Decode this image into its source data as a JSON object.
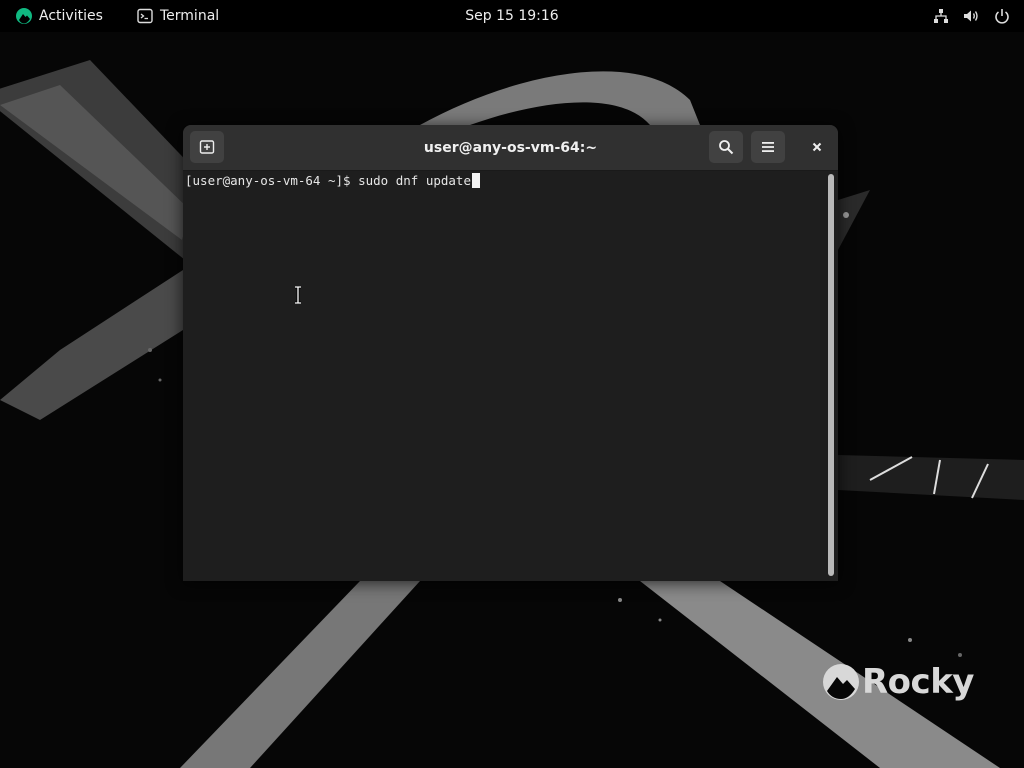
{
  "topbar": {
    "activities_label": "Activities",
    "app_label": "Terminal",
    "clock": "Sep 15  19:16"
  },
  "icons": {
    "activities": "rocky-logo-icon",
    "app": "terminal-icon",
    "network": "network-wired-icon",
    "volume": "volume-icon",
    "power": "power-icon",
    "new_tab": "new-tab-icon",
    "search": "search-icon",
    "menu": "hamburger-menu-icon",
    "close": "close-icon"
  },
  "terminal": {
    "title": "user@any-os-vm-64:~",
    "prompt": "[user@any-os-vm-64 ~]$ ",
    "command": "sudo dnf update"
  },
  "wallpaper": {
    "brand": "Rocky"
  },
  "colors": {
    "topbar_bg": "#000000",
    "headerbar_bg": "#303030",
    "terminal_bg": "#1e1e1e",
    "accent_green": "#10b981"
  }
}
